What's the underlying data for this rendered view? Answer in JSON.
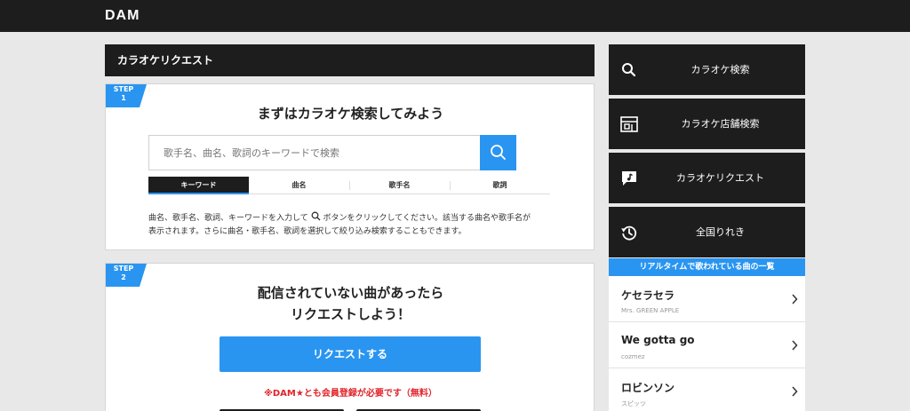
{
  "topbar": {
    "logo": "DAM"
  },
  "main": {
    "header": "カラオケリクエスト",
    "step1": {
      "badge": "STEP",
      "badge_num": "1",
      "title": "まずはカラオケ検索してみよう",
      "search_placeholder": "歌手名、曲名、歌詞のキーワードで検索",
      "tabs": [
        {
          "label": "キーワード",
          "active": true
        },
        {
          "label": "曲名",
          "active": false
        },
        {
          "label": "歌手名",
          "active": false
        },
        {
          "label": "歌詞",
          "active": false
        }
      ],
      "desc_before_icon": "曲名、歌手名、歌詞、キーワードを入力して",
      "desc_after_icon": "ボタンをクリックしてください。該当する曲名や歌手名が",
      "desc_line2": "表示されます。さらに曲名・歌手名、歌詞を選択して絞り込み検索することもできます。"
    },
    "step2": {
      "badge": "STEP",
      "badge_num": "2",
      "title_line1": "配信されていない曲があったら",
      "title_line2": "リクエストしよう！",
      "button": "リクエストする",
      "notice": "※DAM★とも会員登録が必要です（無料）"
    }
  },
  "sidebar": {
    "items": [
      {
        "label": "カラオケ検索",
        "icon": "search-icon"
      },
      {
        "label": "カラオケ店舗検索",
        "icon": "store-icon"
      },
      {
        "label": "カラオケリクエスト",
        "icon": "request-icon"
      },
      {
        "label": "全国りれき",
        "icon": "history-icon"
      }
    ],
    "realtime_header": "リアルタイムで歌われている曲の一覧",
    "realtime": [
      {
        "title": "ケセラセラ",
        "artist": "Mrs. GREEN APPLE"
      },
      {
        "title": "We gotta go",
        "artist": "cozmez"
      },
      {
        "title": "ロビンソン",
        "artist": "スピッツ"
      }
    ]
  },
  "colors": {
    "accent": "#2a95f0",
    "dark": "#1d1d1d",
    "notice": "#e0242b"
  }
}
